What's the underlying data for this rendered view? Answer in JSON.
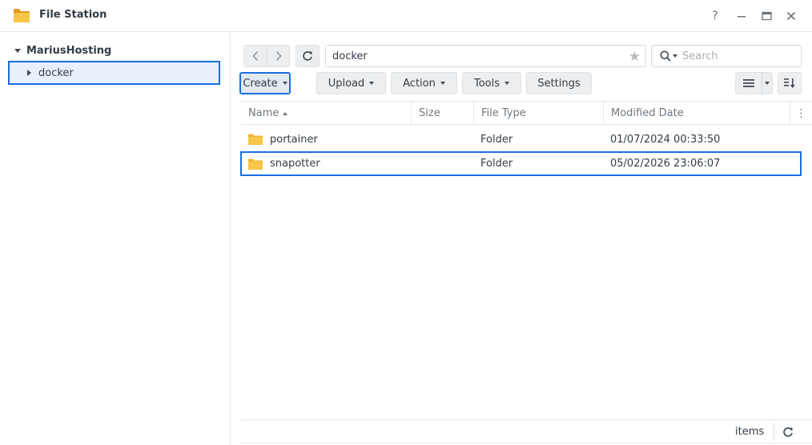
{
  "window": {
    "title": "File Station",
    "help_icon": "?"
  },
  "tree": {
    "root_label": "MariusHosting",
    "items": [
      {
        "label": "docker"
      }
    ]
  },
  "toolbar": {
    "path": "docker",
    "search_placeholder": "Search",
    "buttons": {
      "create": "Create",
      "upload": "Upload",
      "action": "Action",
      "tools": "Tools",
      "settings": "Settings"
    }
  },
  "table": {
    "columns": [
      "Name",
      "Size",
      "File Type",
      "Modified Date"
    ],
    "sort_column": "Name",
    "sort_direction": "ascending",
    "rows": [
      {
        "name": "portainer",
        "size": "",
        "type": "Folder",
        "modified": "01/07/2024 00:33:50",
        "selected": false
      },
      {
        "name": "snapotter",
        "size": "",
        "type": "Folder",
        "modified": "05/02/2026 23:06:07",
        "selected": true
      }
    ]
  },
  "footer": {
    "items_label": "items"
  },
  "colors": {
    "accent": "#1b6ee0",
    "folder": "#f7c648"
  }
}
